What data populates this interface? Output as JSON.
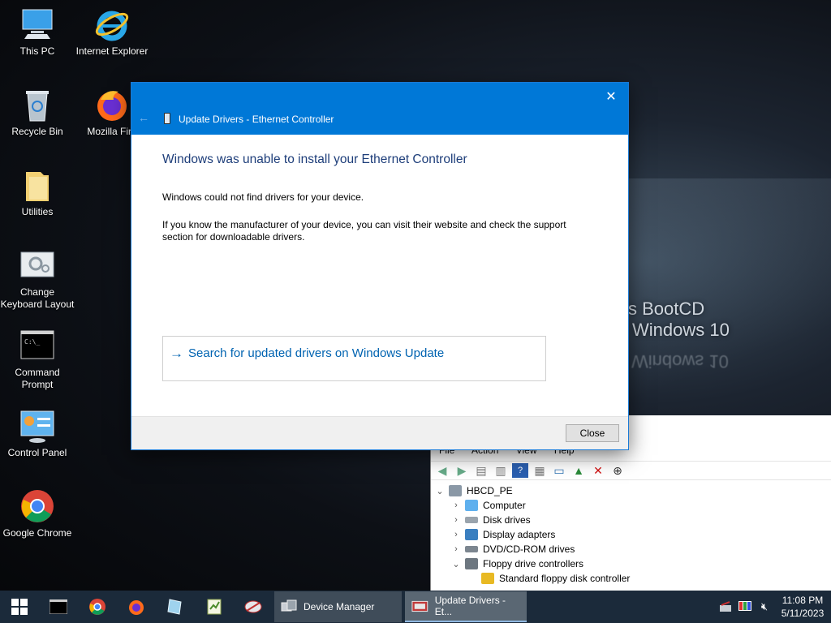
{
  "desktop": {
    "icons": [
      {
        "label": "This PC"
      },
      {
        "label": "Internet Explorer"
      },
      {
        "label": "Recycle Bin"
      },
      {
        "label": "Mozilla Fire"
      },
      {
        "label": "Utilities"
      },
      {
        "label": "Change Keyboard Layout"
      },
      {
        "label": "Command Prompt"
      },
      {
        "label": "Control Panel"
      },
      {
        "label": "Google Chrome"
      }
    ],
    "wallpaper_line1": "en’s BootCD",
    "wallpaper_line2": "Windows 10"
  },
  "dialog": {
    "caption": "Update Drivers - Ethernet Controller",
    "heading": "Windows was unable to install your Ethernet Controller",
    "para1": "Windows could not find drivers for your device.",
    "para2": "If you know the manufacturer of your device, you can visit their website and check the support section for downloadable drivers.",
    "link_text": "Search for updated drivers on Windows Update",
    "close_label": "Close",
    "close_glyph": "✕",
    "accent": "#0078d7"
  },
  "device_manager": {
    "menu": [
      "File",
      "Action",
      "View",
      "Help"
    ],
    "tree": [
      {
        "label": "HBCD_PE",
        "expanded": true
      },
      {
        "label": "Computer"
      },
      {
        "label": "Disk drives"
      },
      {
        "label": "Display adapters"
      },
      {
        "label": "DVD/CD-ROM drives"
      },
      {
        "label": "Floppy drive controllers",
        "expanded": true
      },
      {
        "label": "Standard floppy disk controller"
      }
    ]
  },
  "taskbar": {
    "tasks": [
      {
        "label": "Device Manager"
      },
      {
        "label": "Update Drivers - Et..."
      }
    ],
    "time": "11:08 PM",
    "date": "5/11/2023"
  }
}
